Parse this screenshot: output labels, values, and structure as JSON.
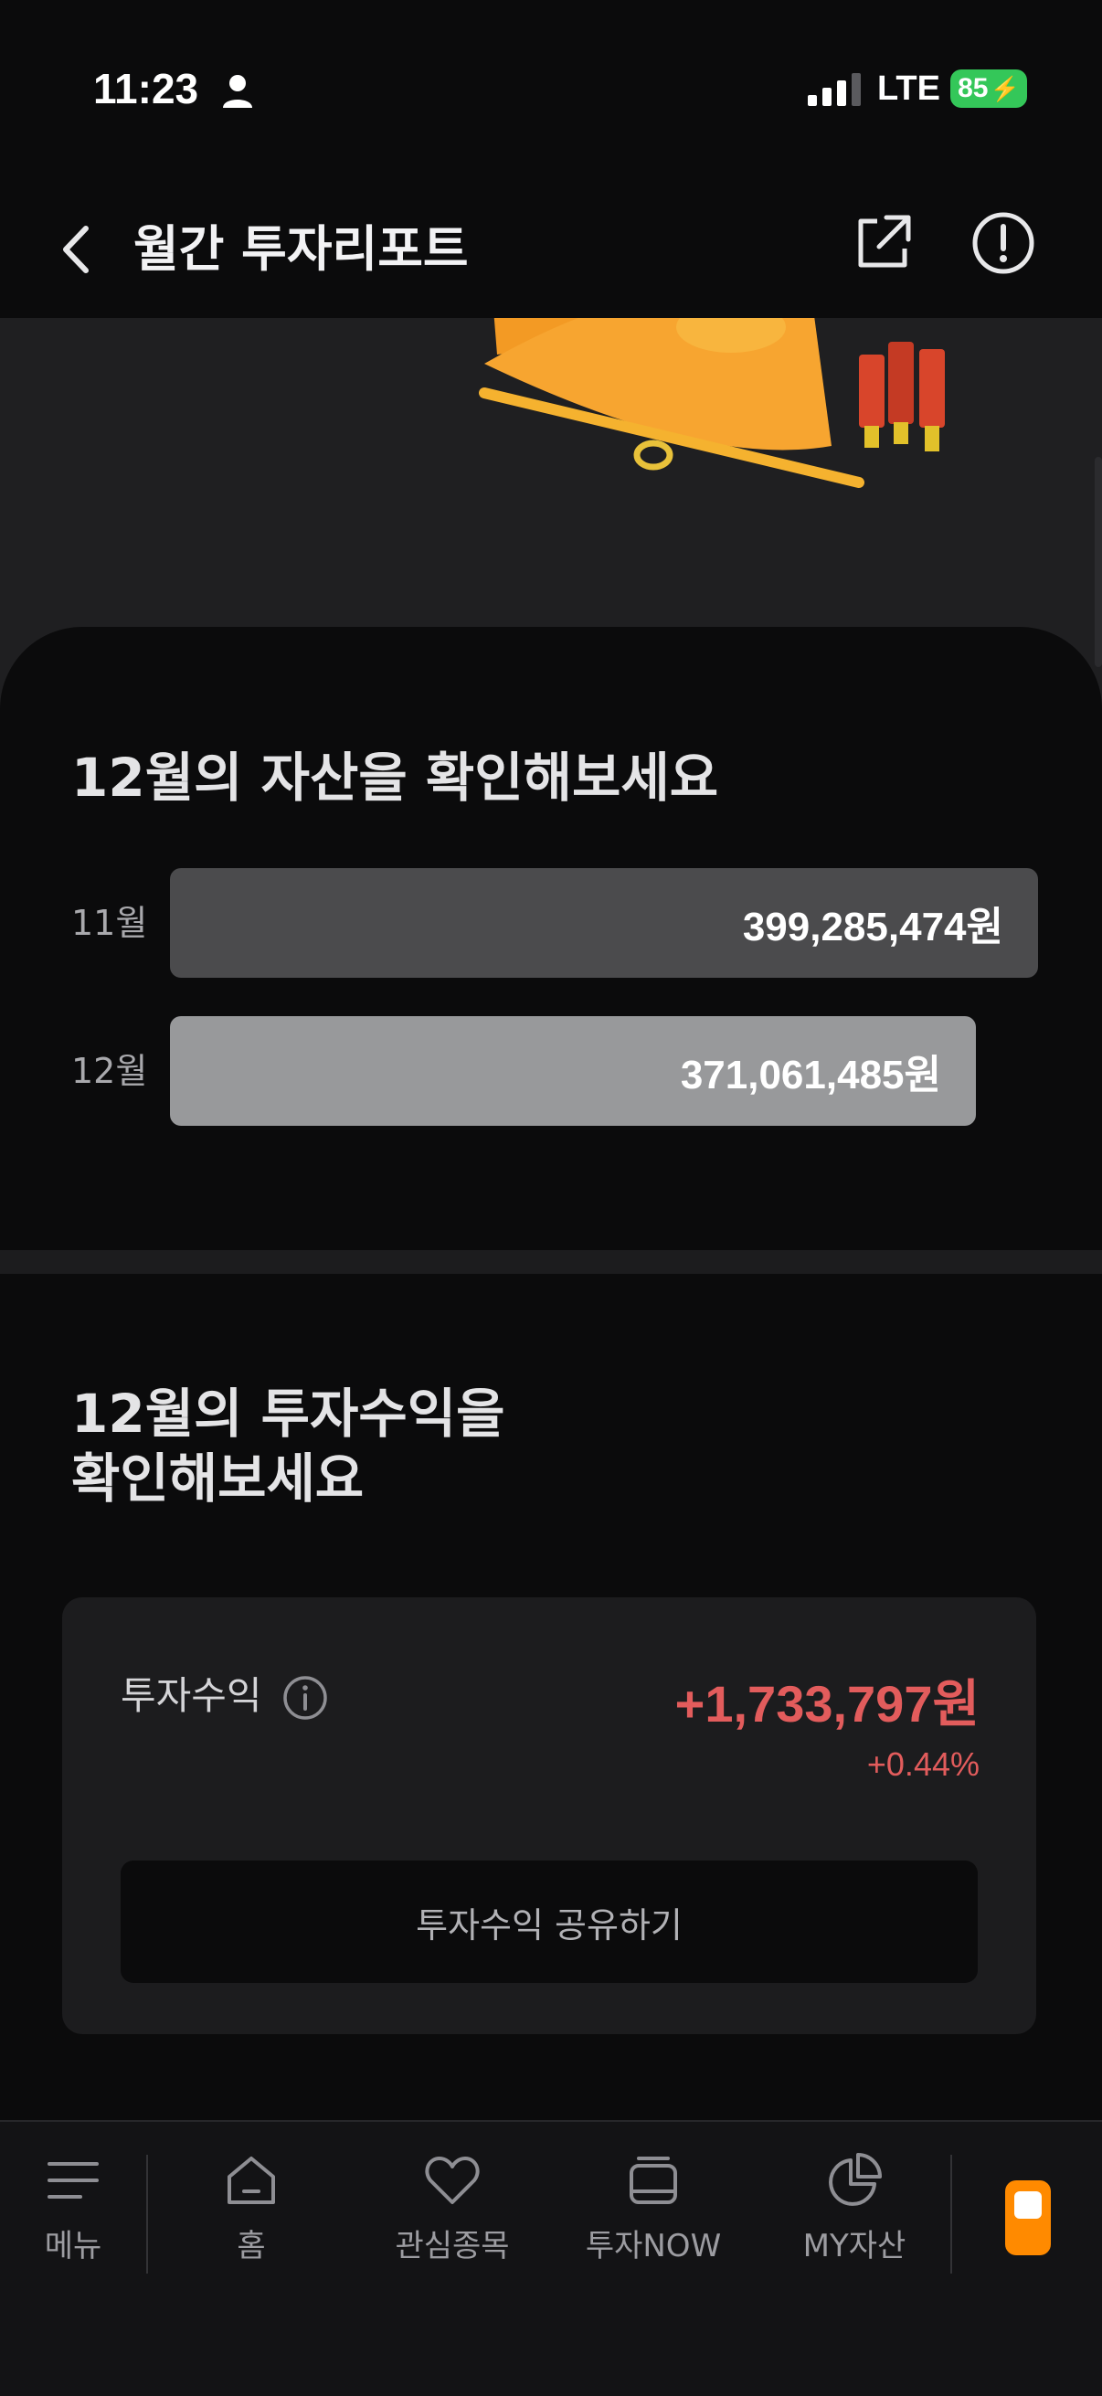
{
  "status_bar": {
    "time": "11:23",
    "network": "LTE",
    "battery": "85"
  },
  "header": {
    "title": "월간 투자리포트"
  },
  "assets": {
    "title": "12월의 자산을 확인해보세요",
    "rows": [
      {
        "month": "11월",
        "amount": "399,285,474원",
        "value": 399285474
      },
      {
        "month": "12월",
        "amount": "371,061,485원",
        "value": 371061485
      }
    ]
  },
  "profit": {
    "title_line1": "12월의 투자수익을",
    "title_line2": "확인해보세요",
    "label": "투자수익",
    "value": "+1,733,797원",
    "rate": "+0.44%",
    "share_button": "투자수익 공유하기"
  },
  "bottom_nav": {
    "menu": "메뉴",
    "home": "홈",
    "watchlist": "관심종목",
    "now": "투자NOW",
    "my_assets": "MY자산"
  },
  "colors": {
    "background": "#0b0b0c",
    "profit_red": "#e25c5c",
    "bar_nov": "#4b4b4d",
    "bar_dec": "#98999b",
    "accent_orange": "#ff8a00"
  }
}
